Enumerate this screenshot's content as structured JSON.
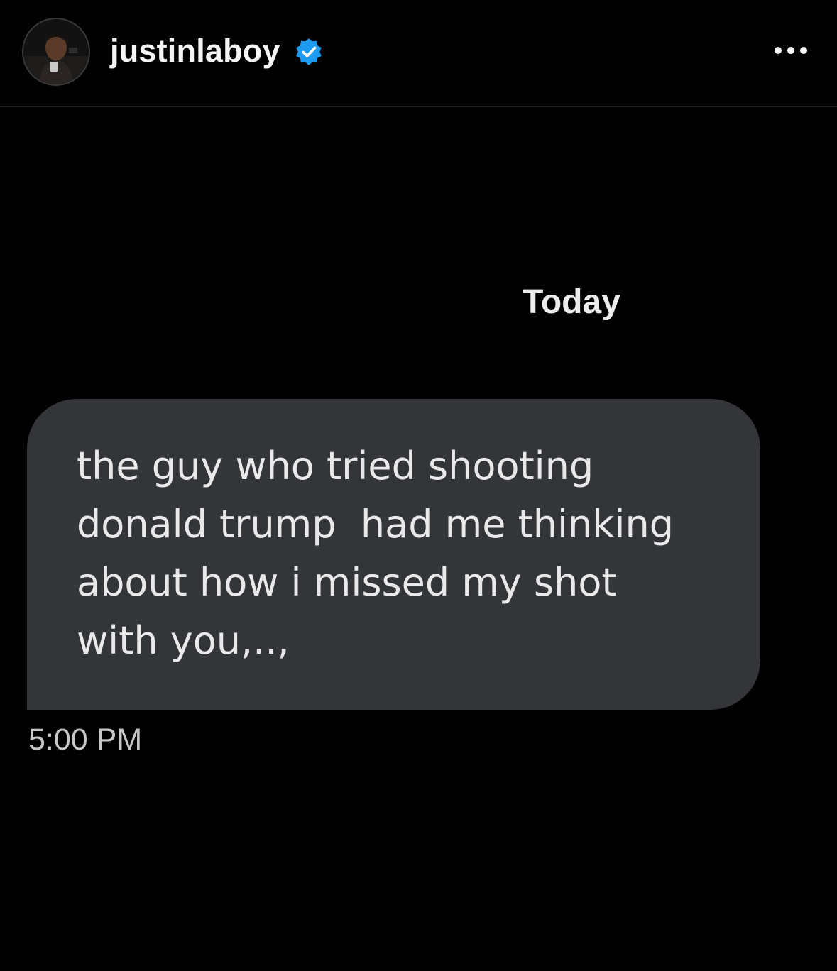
{
  "header": {
    "username": "justinlaboy",
    "verified": true,
    "avatar_icon": "profile-avatar",
    "menu_icon": "more-horizontal-icon",
    "verified_color": "#1d9bf0"
  },
  "conversation": {
    "date_label": "Today",
    "messages": [
      {
        "text": "the guy who tried shooting\ndonald trump  had me thinking\nabout how i missed my shot\nwith you,..,",
        "time": "5:00 PM",
        "bubble_color": "#333538"
      }
    ]
  }
}
